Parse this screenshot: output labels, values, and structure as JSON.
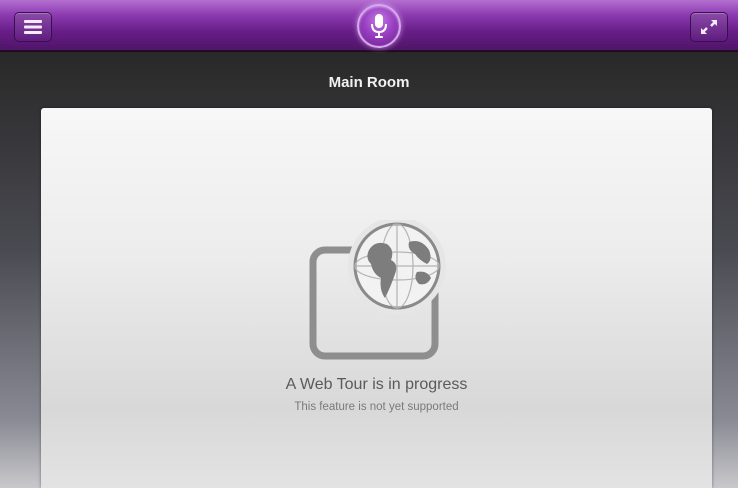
{
  "header": {
    "menu_icon": "hamburger-menu-icon",
    "mic_icon": "microphone-icon",
    "expand_icon": "expand-arrows-icon",
    "accent_color": "#7a2a9c"
  },
  "room": {
    "title": "Main Room"
  },
  "web_tour": {
    "icon": "globe-window-icon",
    "message": "A Web Tour is in progress",
    "submessage": "This feature is not yet supported"
  }
}
